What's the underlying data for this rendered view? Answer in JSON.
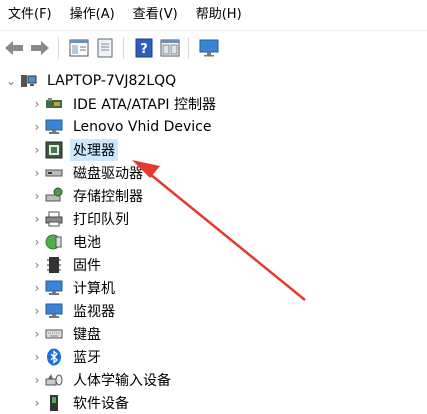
{
  "menu": [
    "文件(F)",
    "操作(A)",
    "查看(V)",
    "帮助(H)"
  ],
  "toolbar": {
    "back_icon": "back-arrow-icon",
    "forward_icon": "forward-arrow-icon",
    "properties_icon": "properties-icon",
    "refresh_icon": "page-icon",
    "help_icon": "help-icon",
    "view_icon": "view-panel-icon",
    "monitor_icon": "monitor-icon"
  },
  "tree": {
    "root": "LAPTOP-7VJ82LQQ",
    "items": [
      {
        "label": "IDE ATA/ATAPI 控制器",
        "icon": "ide-controller-icon"
      },
      {
        "label": "Lenovo Vhid Device",
        "icon": "monitor-icon"
      },
      {
        "label": "处理器",
        "icon": "processor-icon",
        "selected": true
      },
      {
        "label": "磁盘驱动器",
        "icon": "disk-drive-icon"
      },
      {
        "label": "存储控制器",
        "icon": "storage-controller-icon"
      },
      {
        "label": "打印队列",
        "icon": "printer-icon"
      },
      {
        "label": "电池",
        "icon": "battery-icon"
      },
      {
        "label": "固件",
        "icon": "firmware-icon"
      },
      {
        "label": "计算机",
        "icon": "computer-icon"
      },
      {
        "label": "监视器",
        "icon": "monitor-icon"
      },
      {
        "label": "键盘",
        "icon": "keyboard-icon"
      },
      {
        "label": "蓝牙",
        "icon": "bluetooth-icon"
      },
      {
        "label": "人体学输入设备",
        "icon": "hid-icon"
      },
      {
        "label": "软件设备",
        "icon": "software-device-icon"
      }
    ]
  },
  "colors": {
    "selection": "#cce8ff",
    "arrow": "#e5392f"
  }
}
